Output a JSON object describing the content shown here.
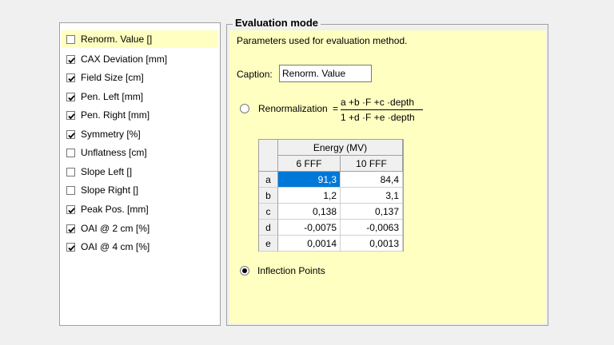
{
  "left_panel": {
    "items": [
      {
        "label": "Renorm. Value []",
        "checked": false,
        "selected": true
      },
      {
        "label": "CAX Deviation [mm]",
        "checked": true
      },
      {
        "label": "Field Size [cm]",
        "checked": true
      },
      {
        "label": "Pen. Left [mm]",
        "checked": true
      },
      {
        "label": "Pen. Right [mm]",
        "checked": true
      },
      {
        "label": "Symmetry [%]",
        "checked": true
      },
      {
        "label": "Unflatness [cm]",
        "checked": false
      },
      {
        "label": "Slope Left []",
        "checked": false
      },
      {
        "label": "Slope Right []",
        "checked": false
      },
      {
        "label": "Peak Pos. [mm]",
        "checked": true
      },
      {
        "label": "OAI @ 2 cm [%]",
        "checked": true
      },
      {
        "label": "OAI @ 4 cm [%]",
        "checked": true
      }
    ]
  },
  "group": {
    "title": "Evaluation mode",
    "description": "Parameters used for evaluation method.",
    "caption_label": "Caption:",
    "caption_value": "Renorm. Value",
    "renorm_label": "Renormalization",
    "formula_eq": "=",
    "formula_numerator": "a +b ·F +c ·depth",
    "formula_denominator": "1 +d ·F +e ·depth",
    "renorm_selected": false,
    "inflection_label": "Inflection Points",
    "inflection_selected": true
  },
  "table": {
    "group_header": "Energy (MV)",
    "columns": [
      "6 FFF",
      "10 FFF"
    ],
    "rows": [
      {
        "label": "a",
        "values": [
          "91,3",
          "84,4"
        ]
      },
      {
        "label": "b",
        "values": [
          "1,2",
          "3,1"
        ]
      },
      {
        "label": "c",
        "values": [
          "0,138",
          "0,137"
        ]
      },
      {
        "label": "d",
        "values": [
          "-0,0075",
          "-0,0063"
        ]
      },
      {
        "label": "e",
        "values": [
          "0,0014",
          "0,0013"
        ]
      }
    ]
  },
  "colors": {
    "panel_yellow": "#ffffc2",
    "selection_blue": "#0078d7"
  }
}
